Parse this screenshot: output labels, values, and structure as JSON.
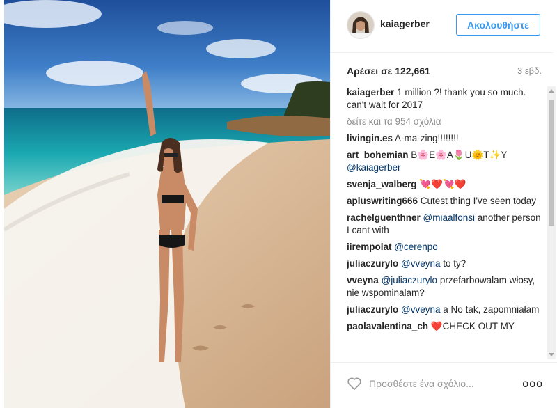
{
  "post": {
    "username": "kaiagerber",
    "follow_label": "Ακολουθήστε",
    "likes_text": "Αρέσει σε 122,661",
    "time_ago": "3 εβδ.",
    "caption_user": "kaiagerber",
    "caption_text": "1 million ?! thank you so much. can't wait for 2017",
    "view_all": "δείτε και τα 954 σχόλια"
  },
  "comments": [
    {
      "user": "livingin.es",
      "text": "A-ma-zing!!!!!!!!",
      "mention": ""
    },
    {
      "user": "art_bohemian",
      "text": "B🌸E🌸A🌷U🌞T✨Y",
      "mention": "@kaiagerber"
    },
    {
      "user": "svenja_walberg",
      "text": "💘❤️💘❤️",
      "mention": ""
    },
    {
      "user": "apluswriting666",
      "text": "Cutest thing I've seen today",
      "mention": ""
    },
    {
      "user": "rachelguenthner",
      "mention": "@miaalfonsi",
      "text": "another person I cant with"
    },
    {
      "user": "iirempolat",
      "mention": "@cerenpo",
      "text": ""
    },
    {
      "user": "juliaczurylo",
      "mention": "@vveyna",
      "text": "to ty?"
    },
    {
      "user": "vveyna",
      "mention": "@juliaczurylo",
      "text": "przefarbowalam włosy, nie wspominalam?"
    },
    {
      "user": "juliaczurylo",
      "mention": "@vveyna",
      "text": "a No tak, zapomniałam"
    },
    {
      "user": "paolavalentina_ch",
      "mention": "",
      "text": "❤️CHECK OUT MY"
    }
  ],
  "footer": {
    "comment_placeholder": "Προσθέστε ένα σχόλιο...",
    "more_label": "ooo"
  },
  "colors": {
    "accent": "#3897f0",
    "mention": "#003569",
    "muted": "#8e8e8e"
  }
}
